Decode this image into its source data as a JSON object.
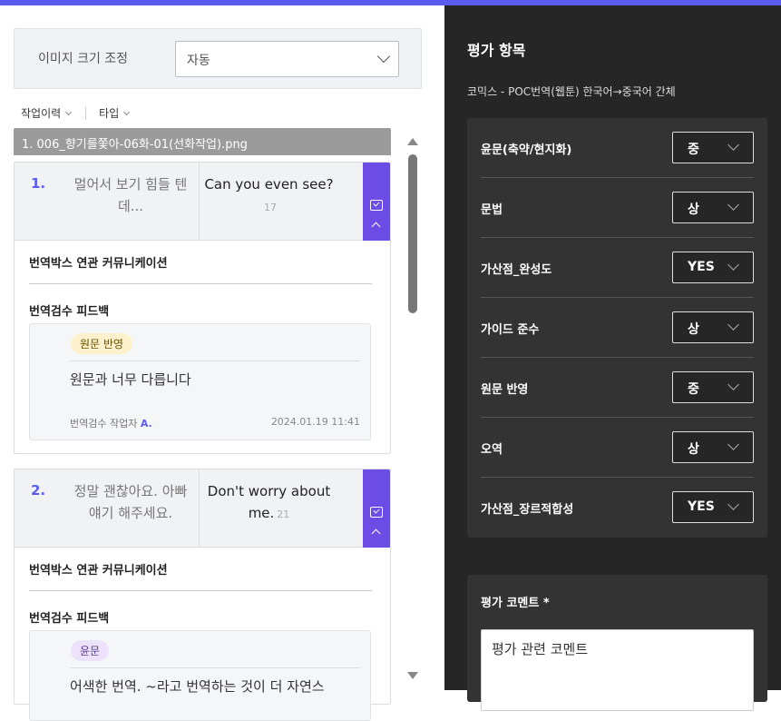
{
  "size_adjust": {
    "label": "이미지 크기 조정",
    "value": "자동"
  },
  "filters": {
    "history": "작업이력",
    "type": "타입"
  },
  "file": {
    "name": "1. 006_향기를쫓아-06화-01(선화작업).png"
  },
  "items": [
    {
      "num": "1.",
      "source": "멀어서 보기 힘들 텐데...",
      "target": "Can you even see?",
      "count": "17",
      "section_comm": "번역박스 연관 커뮤니케이션",
      "section_fb": "번역검수 피드백",
      "feedback": {
        "tag": "원문 반영",
        "text": "원문과 너무 다릅니다",
        "author_prefix": "번역검수 작업자",
        "author": "A.",
        "date": "2024.01.19 11:41"
      }
    },
    {
      "num": "2.",
      "source": "정말 괜찮아요. 아빠 얘기 해주세요.",
      "target": "Don't worry about me.",
      "count": "21",
      "section_comm": "번역박스 연관 커뮤니케이션",
      "section_fb": "번역검수 피드백",
      "feedback": {
        "tag": "윤문",
        "text": "어색한 번역. ~라고 번역하는 것이 더 자연스"
      }
    }
  ],
  "right": {
    "title": "평가 항목",
    "subtitle": "코믹스 - POC번역(웹툰) 한국어→중국어 간체",
    "criteria": [
      {
        "label": "윤문(축약/현지화)",
        "value": "중"
      },
      {
        "label": "문법",
        "value": "상"
      },
      {
        "label": "가산점_완성도",
        "value": "YES"
      },
      {
        "label": "가이드 준수",
        "value": "상"
      },
      {
        "label": "원문 반영",
        "value": "중"
      },
      {
        "label": "오역",
        "value": "상"
      },
      {
        "label": "가산점_장르적합성",
        "value": "YES"
      }
    ],
    "comment_label": "평가 코멘트 *",
    "comment_placeholder": "평가 관련 코멘트"
  },
  "colors": {
    "accent": "#5b5bf0",
    "tab": "#6b4de6",
    "panel": "#262626"
  }
}
